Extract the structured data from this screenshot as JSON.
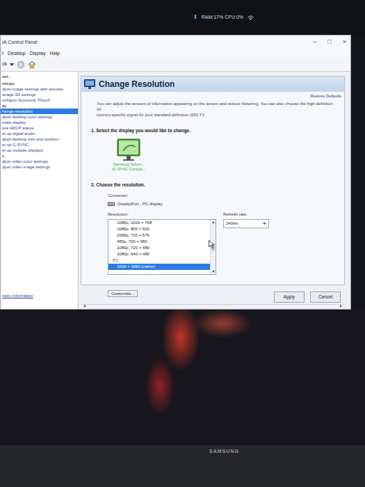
{
  "taskbar": {
    "status": "RAM:17% CPU:0%"
  },
  "window": {
    "title": "IA Control Panel",
    "controls": [
      "–",
      "□",
      "×"
    ]
  },
  "menu": [
    "t",
    "Desktop",
    "Display",
    "Help"
  ],
  "toolbar": {
    "back": "ck"
  },
  "tasks": [
    {
      "label": "ask...",
      "kind": "header",
      "selected": false
    },
    {
      "label": "ettings",
      "kind": "category",
      "selected": false
    },
    {
      "label": "djust image settings with preview",
      "kind": "task",
      "selected": false
    },
    {
      "label": "anage 3D settings",
      "kind": "task",
      "selected": false
    },
    {
      "label": "onfigure Surround, PhysX",
      "kind": "task",
      "selected": false
    },
    {
      "label": "ay",
      "kind": "category",
      "selected": false
    },
    {
      "label": "hange resolution",
      "kind": "task",
      "selected": true
    },
    {
      "label": "djust desktop color settings",
      "kind": "task",
      "selected": false
    },
    {
      "label": "otate display",
      "kind": "task",
      "selected": false
    },
    {
      "label": "iew HDCP status",
      "kind": "task",
      "selected": false
    },
    {
      "label": "et up digital audio",
      "kind": "task",
      "selected": false
    },
    {
      "label": "djust desktop size and position",
      "kind": "task",
      "selected": false
    },
    {
      "label": "et up G-SYNC",
      "kind": "task",
      "selected": false
    },
    {
      "label": "et up multiple displays",
      "kind": "task",
      "selected": false
    },
    {
      "label": "o",
      "kind": "category",
      "selected": false
    },
    {
      "label": "djust video color settings",
      "kind": "task",
      "selected": false
    },
    {
      "label": "djust video image settings",
      "kind": "task",
      "selected": false
    }
  ],
  "system_info": "stem Information",
  "page": {
    "title": "Change Resolution",
    "restore": "Restore Defaults",
    "description": [
      "You can adjust the amount of information appearing on the screen and reduce flickering. You can also choose the high-definition (H",
      "country-specific signal for your standard-definition (SD) TV"
    ],
    "step1": "1. Select the display you would like to change.",
    "display": {
      "name": "Samsung Odyss...",
      "sub": "(G-SYNC Compat...",
      "selected": true
    },
    "step2": "2. Choose the resolution.",
    "connector_label": "Connector:",
    "connector": "DisplayPort - PC display",
    "resolution_label": "Resolution:",
    "resolutions": [
      {
        "label": "1080p, 1024 × 768",
        "kind": "mode",
        "selected": false
      },
      {
        "label": "1080p, 800 × 600",
        "kind": "mode",
        "selected": false
      },
      {
        "label": "1080p, 720 × 576",
        "kind": "mode",
        "selected": false
      },
      {
        "label": "480p, 720 × 480",
        "kind": "mode",
        "selected": false
      },
      {
        "label": "1080p, 720 × 480",
        "kind": "mode",
        "selected": false
      },
      {
        "label": "1080p, 640 × 480",
        "kind": "mode",
        "selected": false
      },
      {
        "label": "PC",
        "kind": "group",
        "selected": false
      },
      {
        "label": "1920 × 1080 (native)",
        "kind": "mode",
        "selected": true
      }
    ],
    "refresh_label": "Refresh rate:",
    "refresh": "240Hz",
    "customize": "Customize..."
  },
  "buttons": [
    "Apply",
    "Cancel"
  ],
  "bezel": {
    "brand": "SAMSUNG"
  }
}
